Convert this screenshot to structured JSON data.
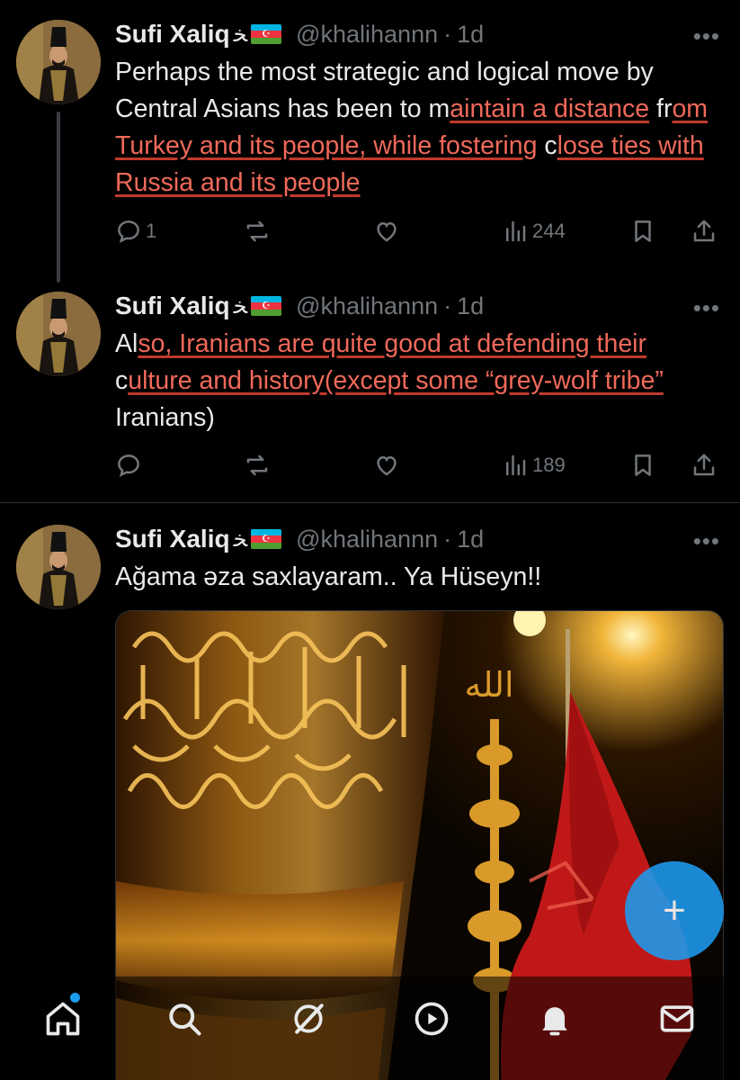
{
  "tweets": [
    {
      "author": {
        "name": "Sufi Xaliq",
        "glyph": "ﺨ",
        "handle": "@khalihannn",
        "time": "1d"
      },
      "text": {
        "a": "Perhaps the most strategic and logical move by Central Asians has been to m",
        "hl1": "aintain a distance",
        "b": " fr",
        "hl2": "om Turkey and its people, while fostering",
        "c": " c",
        "hl3": "lose ties with Russia and its people",
        "d": ""
      },
      "metrics": {
        "replies": "1",
        "reposts": "",
        "likes": "",
        "views": "244"
      }
    },
    {
      "author": {
        "name": "Sufi Xaliq",
        "glyph": "ﺨ",
        "handle": "@khalihannn",
        "time": "1d"
      },
      "text": {
        "a": "Al",
        "hl1": "so, Iranians are quite good at defending their",
        "b": " c",
        "hl2": "ulture and history(except some “grey-wolf tribe”",
        "c": " Iranians)",
        "hl3": "",
        "d": ""
      },
      "metrics": {
        "replies": "",
        "reposts": "",
        "likes": "",
        "views": "189"
      }
    },
    {
      "author": {
        "name": "Sufi Xaliq",
        "glyph": "ﺨ",
        "handle": "@khalihannn",
        "time": "1d"
      },
      "text": {
        "a": "Ağama əza saxlayaram.. Ya Hüseyn!!"
      }
    }
  ],
  "ui": {
    "more": "•••",
    "dot": "·",
    "fab_label": "+"
  },
  "nav": [
    "home-icon",
    "search-icon",
    "grok-icon",
    "video-icon",
    "notifications-icon",
    "messages-icon"
  ],
  "colors": {
    "accent": "#1d9bf0",
    "highlight": "#f0695a",
    "muted": "#71767b"
  }
}
